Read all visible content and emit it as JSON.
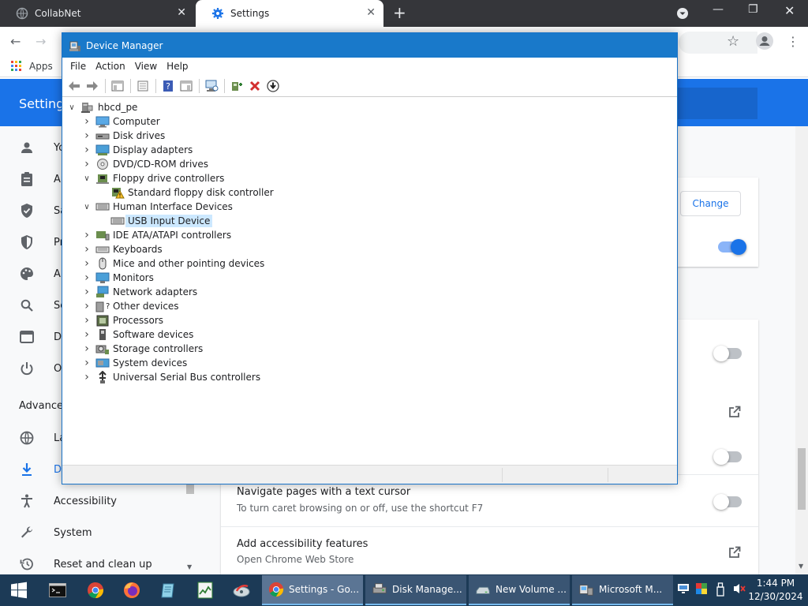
{
  "browser": {
    "tabs": [
      {
        "label": "CollabNet",
        "active": false,
        "close": "✕"
      },
      {
        "label": "Settings",
        "active": true,
        "close": "✕"
      }
    ],
    "new_tab": "+",
    "window_controls": {
      "minimize": "—",
      "restore": "❐",
      "close": "✕"
    },
    "nav": {
      "back": "←",
      "forward": "→",
      "star": "☆",
      "menu": "⋮"
    },
    "bookmarks": {
      "apps_label": "Apps"
    }
  },
  "settings": {
    "header_title": "Settings",
    "sidebar": {
      "items": [
        {
          "label": "Yo",
          "icon": "person-icon"
        },
        {
          "label": "Au",
          "icon": "clipboard-icon"
        },
        {
          "label": "Sa",
          "icon": "shield-check-icon"
        },
        {
          "label": "Pr",
          "icon": "privacy-shield-icon"
        },
        {
          "label": "Ap",
          "icon": "palette-icon"
        },
        {
          "label": "Se",
          "icon": "search-icon"
        },
        {
          "label": "De",
          "icon": "browser-icon"
        },
        {
          "label": "On",
          "icon": "power-icon"
        }
      ],
      "advanced_label": "Advanced",
      "advanced_items": [
        {
          "label": "La",
          "icon": "globe-icon"
        },
        {
          "label": "Do",
          "icon": "download-icon",
          "active": true
        },
        {
          "label": "Accessibility",
          "icon": "accessibility-icon"
        },
        {
          "label": "System",
          "icon": "wrench-icon"
        },
        {
          "label": "Reset and clean up",
          "icon": "history-icon"
        }
      ]
    },
    "change_button": "Change",
    "rows": {
      "caret_title": "Navigate pages with a text cursor",
      "caret_sub": "To turn caret browsing on or off, use the shortcut F7",
      "features_title": "Add accessibility features",
      "features_sub": "Open Chrome Web Store"
    }
  },
  "device_manager": {
    "title": "Device Manager",
    "menu": [
      "File",
      "Action",
      "View",
      "Help"
    ],
    "toolbar": [
      "back-icon",
      "forward-icon",
      "show-hide-tree-icon",
      "properties-icon",
      "help-icon",
      "action-pane-icon",
      "scan-hardware-icon",
      "add-driver-icon",
      "uninstall-icon",
      "update-driver-icon"
    ],
    "tree": {
      "root": "hbcd_pe",
      "nodes": [
        {
          "label": "Computer",
          "level": 1,
          "expanded": false,
          "icon": "computer-icon"
        },
        {
          "label": "Disk drives",
          "level": 1,
          "expanded": false,
          "icon": "disk-drive-icon"
        },
        {
          "label": "Display adapters",
          "level": 1,
          "expanded": false,
          "icon": "display-adapter-icon"
        },
        {
          "label": "DVD/CD-ROM drives",
          "level": 1,
          "expanded": false,
          "icon": "dvd-drive-icon"
        },
        {
          "label": "Floppy drive controllers",
          "level": 1,
          "expanded": true,
          "icon": "floppy-controller-icon"
        },
        {
          "label": "Standard floppy disk controller",
          "level": 2,
          "icon": "floppy-warning-icon"
        },
        {
          "label": "Human Interface Devices",
          "level": 1,
          "expanded": true,
          "icon": "hid-icon"
        },
        {
          "label": "USB Input Device",
          "level": 2,
          "selected": true,
          "icon": "hid-device-icon"
        },
        {
          "label": "IDE ATA/ATAPI controllers",
          "level": 1,
          "expanded": false,
          "icon": "ide-controller-icon"
        },
        {
          "label": "Keyboards",
          "level": 1,
          "expanded": false,
          "icon": "keyboard-icon"
        },
        {
          "label": "Mice and other pointing devices",
          "level": 1,
          "expanded": false,
          "icon": "mouse-icon"
        },
        {
          "label": "Monitors",
          "level": 1,
          "expanded": false,
          "icon": "monitor-icon"
        },
        {
          "label": "Network adapters",
          "level": 1,
          "expanded": false,
          "icon": "network-adapter-icon"
        },
        {
          "label": "Other devices",
          "level": 1,
          "expanded": false,
          "icon": "other-devices-icon"
        },
        {
          "label": "Processors",
          "level": 1,
          "expanded": false,
          "icon": "processor-icon"
        },
        {
          "label": "Software devices",
          "level": 1,
          "expanded": false,
          "icon": "software-device-icon"
        },
        {
          "label": "Storage controllers",
          "level": 1,
          "expanded": false,
          "icon": "storage-controller-icon"
        },
        {
          "label": "System devices",
          "level": 1,
          "expanded": false,
          "icon": "system-devices-icon"
        },
        {
          "label": "Universal Serial Bus controllers",
          "level": 1,
          "expanded": false,
          "icon": "usb-controller-icon"
        }
      ]
    }
  },
  "taskbar": {
    "pinned": [
      "windows-start-icon",
      "terminal-icon",
      "chrome-icon",
      "firefox-icon",
      "notepad-icon",
      "task-manager-icon",
      "tools-icon"
    ],
    "tasks": [
      {
        "label": "Settings - Go...",
        "icon": "chrome-icon",
        "active": true
      },
      {
        "label": "Disk Manage...",
        "icon": "disk-management-icon"
      },
      {
        "label": "New Volume ...",
        "icon": "drive-icon"
      },
      {
        "label": "Microsoft M...",
        "icon": "mmc-icon"
      }
    ],
    "clock": {
      "time": "1:44 PM",
      "date": "12/30/2024"
    }
  },
  "colors": {
    "accent": "#1a73e8",
    "dm_titlebar": "#1979ca",
    "taskbar": "#1c3a56",
    "tab_strip": "#35363a",
    "selection": "#cce8ff"
  }
}
